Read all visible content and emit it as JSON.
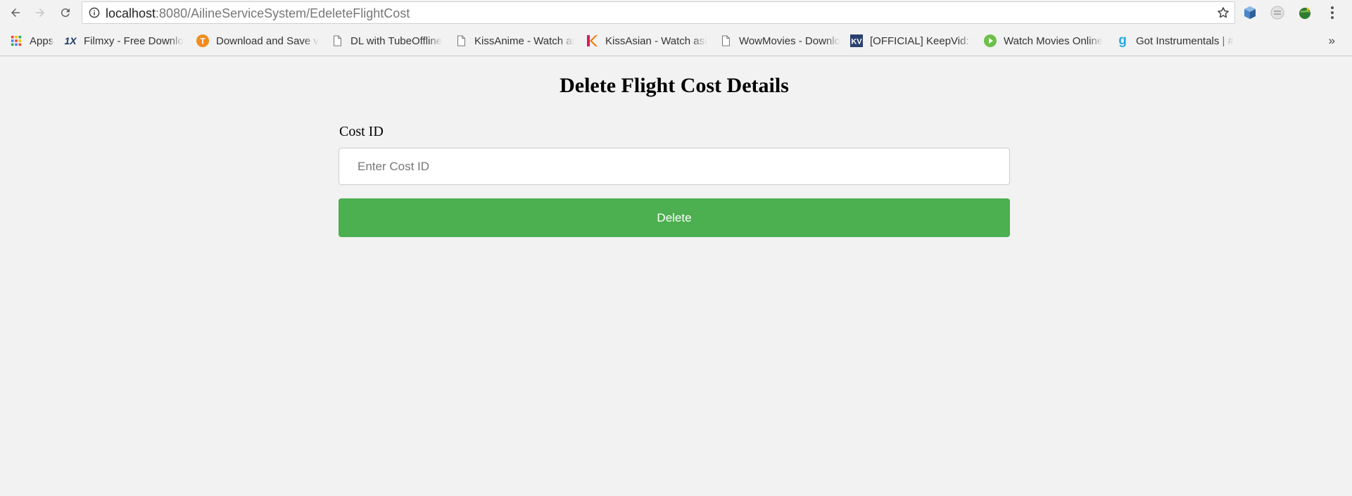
{
  "browser": {
    "url_host": "localhost",
    "url_rest": ":8080/AilineServiceSystem/EdeleteFlightCost",
    "bookmarks": [
      {
        "label": "Apps",
        "icon": "apps-grid-icon"
      },
      {
        "label": "Filmxy - Free Downlo",
        "icon": "filmxy-icon"
      },
      {
        "label": "Download and Save v",
        "icon": "tubeoffline-icon"
      },
      {
        "label": "DL with TubeOffline",
        "icon": "page-icon"
      },
      {
        "label": "KissAnime - Watch ar",
        "icon": "page-icon"
      },
      {
        "label": "KissAsian - Watch asi",
        "icon": "kissasian-icon"
      },
      {
        "label": "WowMovies - Downlo",
        "icon": "page-icon"
      },
      {
        "label": "[OFFICIAL] KeepVid: D",
        "icon": "keepvid-icon"
      },
      {
        "label": "Watch Movies Online",
        "icon": "play-icon"
      },
      {
        "label": "Got Instrumentals | #",
        "icon": "g-icon"
      }
    ],
    "overflow": "»"
  },
  "page": {
    "title": "Delete Flight Cost Details",
    "form": {
      "cost_id_label": "Cost ID",
      "cost_id_placeholder": "Enter Cost ID",
      "cost_id_value": "",
      "delete_label": "Delete"
    }
  },
  "colors": {
    "button_green": "#4caf50",
    "page_background": "#f2f2f2"
  }
}
